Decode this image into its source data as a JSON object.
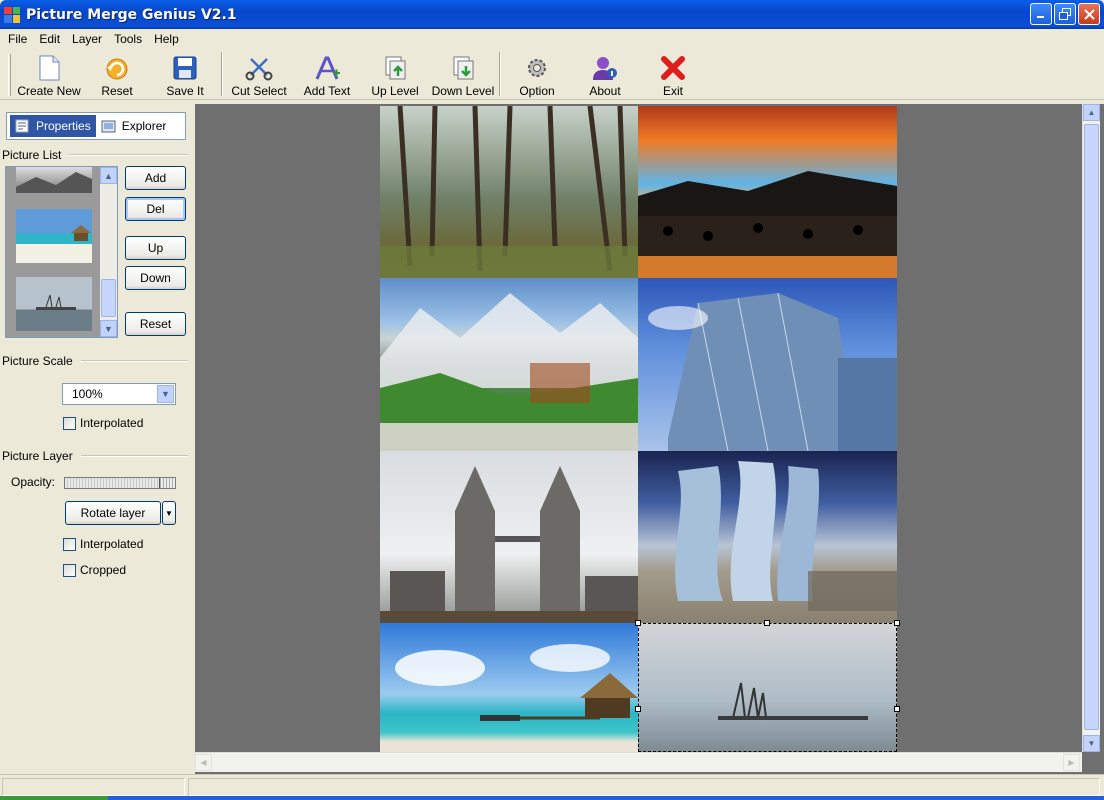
{
  "window": {
    "title": "Picture Merge Genius V2.1"
  },
  "menu": [
    "File",
    "Edit",
    "Layer",
    "Tools",
    "Help"
  ],
  "toolbar": {
    "create_new": "Create New",
    "reset": "Reset",
    "save_it": "Save It",
    "cut_select": "Cut Select",
    "add_text": "Add Text",
    "up_level": "Up Level",
    "down_level": "Down Level",
    "option": "Option",
    "about": "About",
    "exit": "Exit"
  },
  "panel": {
    "tabs": {
      "properties": "Properties",
      "explorer": "Explorer"
    },
    "picture_list": {
      "heading": "Picture List",
      "buttons": {
        "add": "Add",
        "del": "Del",
        "up": "Up",
        "down": "Down",
        "reset": "Reset"
      }
    },
    "picture_scale": {
      "heading": "Picture Scale",
      "scale_value": "100%",
      "interpolated_label": "Interpolated",
      "interpolated_checked": false
    },
    "picture_layer": {
      "heading": "Picture Layer",
      "opacity_label": "Opacity:",
      "opacity_value": 1.0,
      "rotate_button": "Rotate layer",
      "interpolated_label": "Interpolated",
      "interpolated_checked": false,
      "cropped_label": "Cropped",
      "cropped_checked": false
    }
  },
  "canvas": {
    "images": [
      "forest",
      "sunset-lake",
      "mountains",
      "skyscraper",
      "twin-towers",
      "futuristic-towers",
      "tropical-beach",
      "harbor-cranes"
    ],
    "selected": "harbor-cranes"
  },
  "colors": {
    "titlebar": "#0a5ee8",
    "panel_bg": "#ece9d8",
    "canvas_bg": "#6f6f6f",
    "tab_active": "#2e55a6"
  }
}
